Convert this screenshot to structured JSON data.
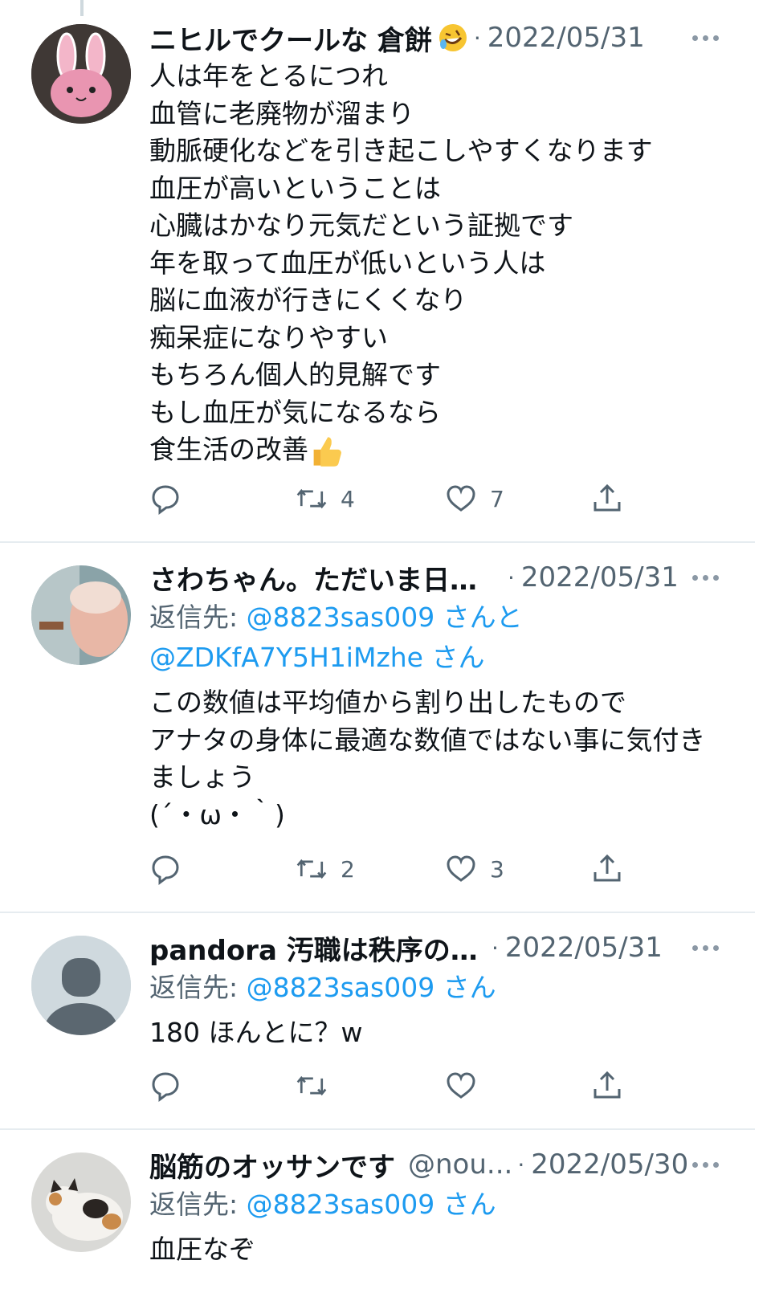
{
  "tweets": [
    {
      "name": "ニヒルでクールな 倉餅",
      "emoji": "rolling-on-floor-laughing-emoji",
      "separator": "·",
      "date": "2022/05/31",
      "lines": [
        "人は年をとるにつれ",
        "血管に老廃物が溜まり",
        "動脈硬化などを引き起こしやすくなります",
        "血圧が高いということは",
        "心臓はかなり元気だという証拠です",
        "年を取って血圧が低いという人は",
        "脳に血液が行きにくくなり",
        "痴呆症になりやすい",
        "もちろん個人的見解です",
        "もし血圧が気になるなら",
        "食生活の改善"
      ],
      "trailing_emoji": "thumbs-up-emoji",
      "retweets": "4",
      "likes": "7"
    },
    {
      "name": "さわちゃん。ただいま日本...",
      "separator": "·",
      "date": "2022/05/31",
      "reply_prefix": "返信先: ",
      "mention1": "@8823sas009",
      "mid": " さんと",
      "mention2": "@ZDKfA7Y5H1iMzhe",
      "suffix": " さん",
      "lines": [
        "この数値は平均値から割り出したもので",
        "アナタの身体に最適な数値ではない事に気付き",
        "ましょう",
        "(´・ω・｀)"
      ],
      "retweets": "2",
      "likes": "3"
    },
    {
      "name": "pandora 汚職は秩序の乱...",
      "separator": "·",
      "date": "2022/05/31",
      "reply_prefix": "返信先: ",
      "mention1": "@8823sas009",
      "suffix": " さん",
      "lines": [
        "180 ほんとに？w"
      ],
      "retweets": "",
      "likes": ""
    },
    {
      "name": "脳筋のオッサンです",
      "handle": "@nou...",
      "separator": "·",
      "date": "2022/05/30",
      "reply_prefix": "返信先: ",
      "mention1": "@8823sas009",
      "suffix": " さん",
      "lines": [
        "血圧なぞ"
      ]
    }
  ]
}
